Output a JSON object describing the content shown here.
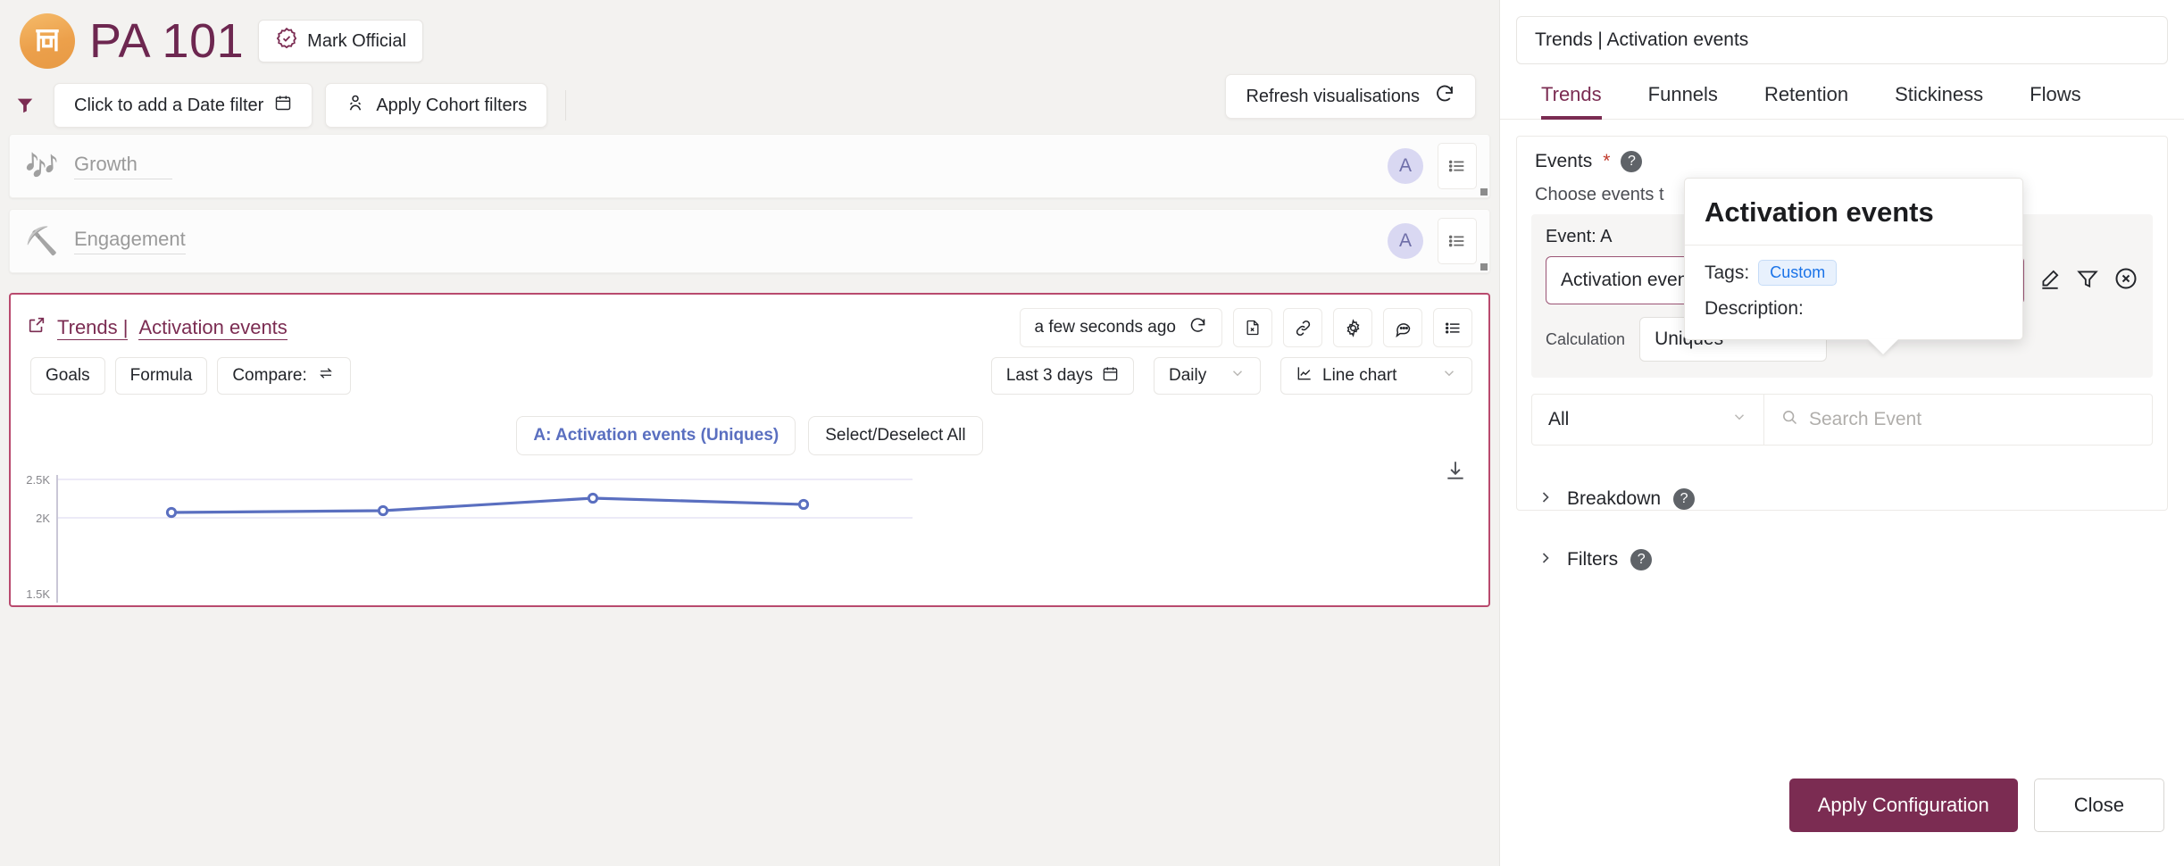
{
  "header": {
    "project_title": "PA 101",
    "mark_official_label": "Mark Official",
    "logo_icon": "torii-gate-icon"
  },
  "filterbar": {
    "filter_icon": "funnel-icon",
    "date_filter_label": "Click to add a Date filter",
    "date_icon": "calendar-icon",
    "cohort_icon": "people-icon",
    "cohort_filter_label": "Apply Cohort filters",
    "refresh_label": "Refresh visualisations",
    "refresh_icon": "refresh-icon"
  },
  "sections": [
    {
      "emoji": "🎶",
      "emoji_name": "musical-notes-icon",
      "name": "Growth",
      "avatar": "A",
      "menu_icon": "list-menu-icon"
    },
    {
      "emoji": "⛏️",
      "emoji_name": "pick-hammer-icon",
      "name": "Engagement",
      "avatar": "A",
      "menu_icon": "list-menu-icon"
    }
  ],
  "card": {
    "open_icon": "external-link-icon",
    "title_prefix": "Trends | ",
    "title": "Activation events",
    "last_refreshed": "a few seconds ago",
    "refresh_icon": "refresh-icon",
    "tools": [
      {
        "icon": "excel-export-icon"
      },
      {
        "icon": "link-icon"
      },
      {
        "icon": "gear-icon"
      },
      {
        "icon": "comment-icon"
      },
      {
        "icon": "list-menu-icon"
      }
    ],
    "controls": {
      "goals_label": "Goals",
      "formula_label": "Formula",
      "compare_label": "Compare:",
      "compare_icon": "swap-arrows-icon",
      "date_range": "Last 3 days",
      "date_icon": "calendar-icon",
      "granularity": "Daily",
      "chart_type": "Line chart",
      "chart_type_icon": "line-chart-icon",
      "chevron_icon": "chevron-down-icon"
    },
    "legend": {
      "series_label": "A: Activation events (Uniques)",
      "select_all_label": "Select/Deselect All"
    },
    "download_icon": "download-icon"
  },
  "chart_data": {
    "type": "line",
    "title": "Trends | Activation events",
    "series": [
      {
        "name": "A: Activation events (Uniques)",
        "color": "#5a6fc0",
        "values": [
          2060,
          2070,
          2140,
          2110
        ]
      }
    ],
    "x": [
      1,
      2,
      3,
      4
    ],
    "ytick_labels": [
      "2.5K",
      "2K",
      "1.5K"
    ],
    "ytick_values": [
      2500,
      2000,
      1500
    ],
    "ylim": [
      1500,
      2500
    ],
    "grid": true,
    "legend_position": "top-center",
    "xlabel": "",
    "ylabel": ""
  },
  "panel": {
    "name_value": "Trends | Activation events",
    "tabs": [
      {
        "label": "Trends",
        "active": true
      },
      {
        "label": "Funnels",
        "active": false
      },
      {
        "label": "Retention",
        "active": false
      },
      {
        "label": "Stickiness",
        "active": false
      },
      {
        "label": "Flows",
        "active": false
      }
    ],
    "events_label": "Events",
    "events_required_mark": "*",
    "help_icon": "help-icon",
    "choose_text": "Choose events t",
    "event": {
      "label": "Event: A",
      "value": "Activation events",
      "visibility_icon": "eye-icon",
      "chevron_icon": "chevron-down-icon",
      "edit_icon": "pencil-icon",
      "filter_icon": "funnel-icon",
      "remove_icon": "close-circle-icon",
      "calculation_label": "Calculation",
      "calculation_value": "Uniques"
    },
    "search": {
      "scope_value": "All",
      "scope_chevron": "chevron-down-icon",
      "search_icon": "search-icon",
      "placeholder": "Search Event"
    },
    "accordions": [
      {
        "label": "Breakdown",
        "chevron": "chevron-right-icon",
        "help_icon": "help-icon"
      },
      {
        "label": "Filters",
        "chevron": "chevron-right-icon",
        "help_icon": "help-icon"
      }
    ],
    "apply_label": "Apply Configuration",
    "close_label": "Close"
  },
  "tooltip": {
    "title": "Activation events",
    "tags_label": "Tags:",
    "tag_value": "Custom",
    "description_label": "Description:"
  },
  "colors": {
    "brand_purple": "#7b2c52",
    "accent_orange": "#eca04b",
    "series_blue": "#5a6fc0",
    "card_border": "#b94a6e"
  }
}
